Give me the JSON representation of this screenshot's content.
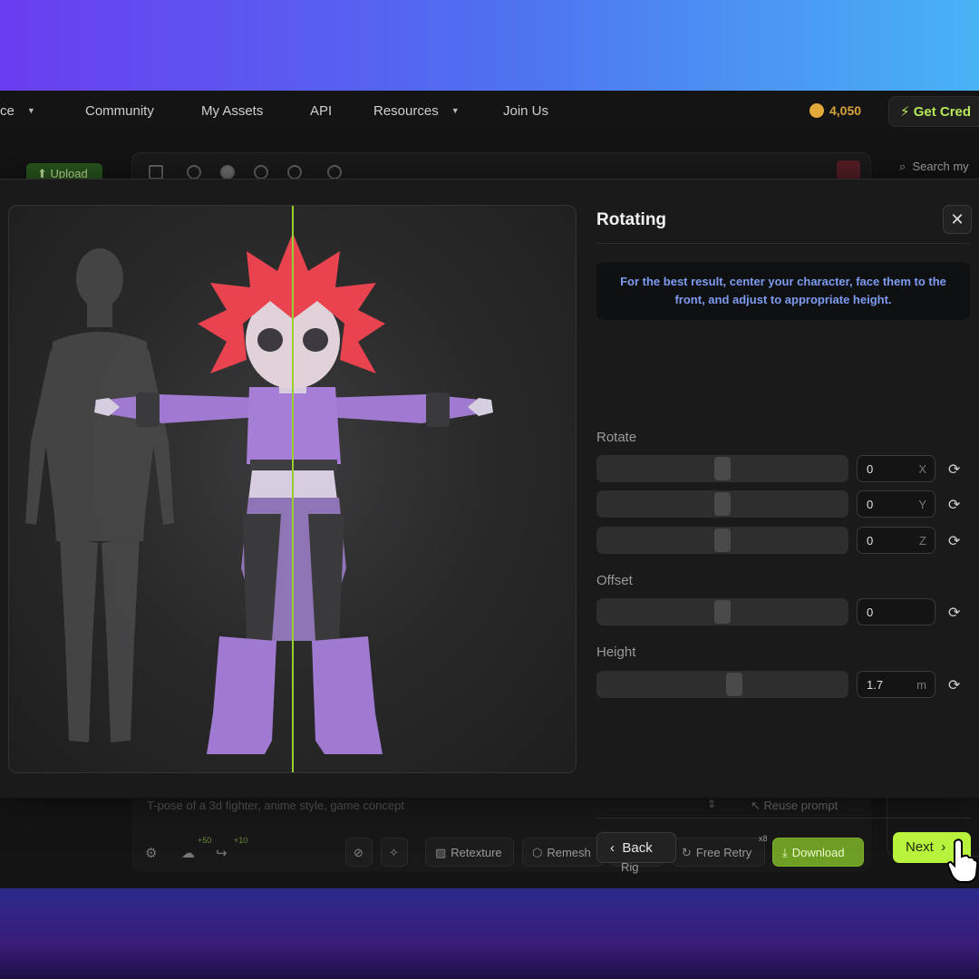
{
  "nav": {
    "partial_item": "ce",
    "items": [
      {
        "label": "Community"
      },
      {
        "label": "My Assets"
      },
      {
        "label": "API"
      },
      {
        "label": "Resources"
      },
      {
        "label": "Join Us"
      }
    ],
    "credits": "4,050",
    "get_credits": "Get Cred"
  },
  "background": {
    "upload": "Upload",
    "search": "Search my",
    "prompt": "T-pose of a 3d fighter, anime style, game concept",
    "reuse_prompt": "Reuse prompt",
    "badges": {
      "upload": "+50",
      "share": "+10",
      "free_retry": "x8"
    },
    "tools": {
      "retexture": "Retexture",
      "remesh": "Remesh",
      "rig": "Rig",
      "free_retry": "Free Retry",
      "download": "Download"
    }
  },
  "modal": {
    "title": "Rotating",
    "close": "✕",
    "info": "For the best result, center your character, face them to the front, and adjust to appropriate height.",
    "rotate_label": "Rotate",
    "rotate": [
      {
        "value": "0",
        "axis": "X",
        "slider": 0.5
      },
      {
        "value": "0",
        "axis": "Y",
        "slider": 0.5
      },
      {
        "value": "0",
        "axis": "Z",
        "slider": 0.5
      }
    ],
    "offset_label": "Offset",
    "offset": {
      "value": "0",
      "slider": 0.5
    },
    "height_label": "Height",
    "height": {
      "value": "1.7",
      "unit": "m",
      "slider": 0.55
    },
    "back": "Back",
    "next": "Next"
  },
  "colors": {
    "accent": "#b8f23c",
    "info_text": "#7d9cf0",
    "hair": "#e8434f",
    "suit": "#a07ad0",
    "center_line": "#9acd32"
  }
}
